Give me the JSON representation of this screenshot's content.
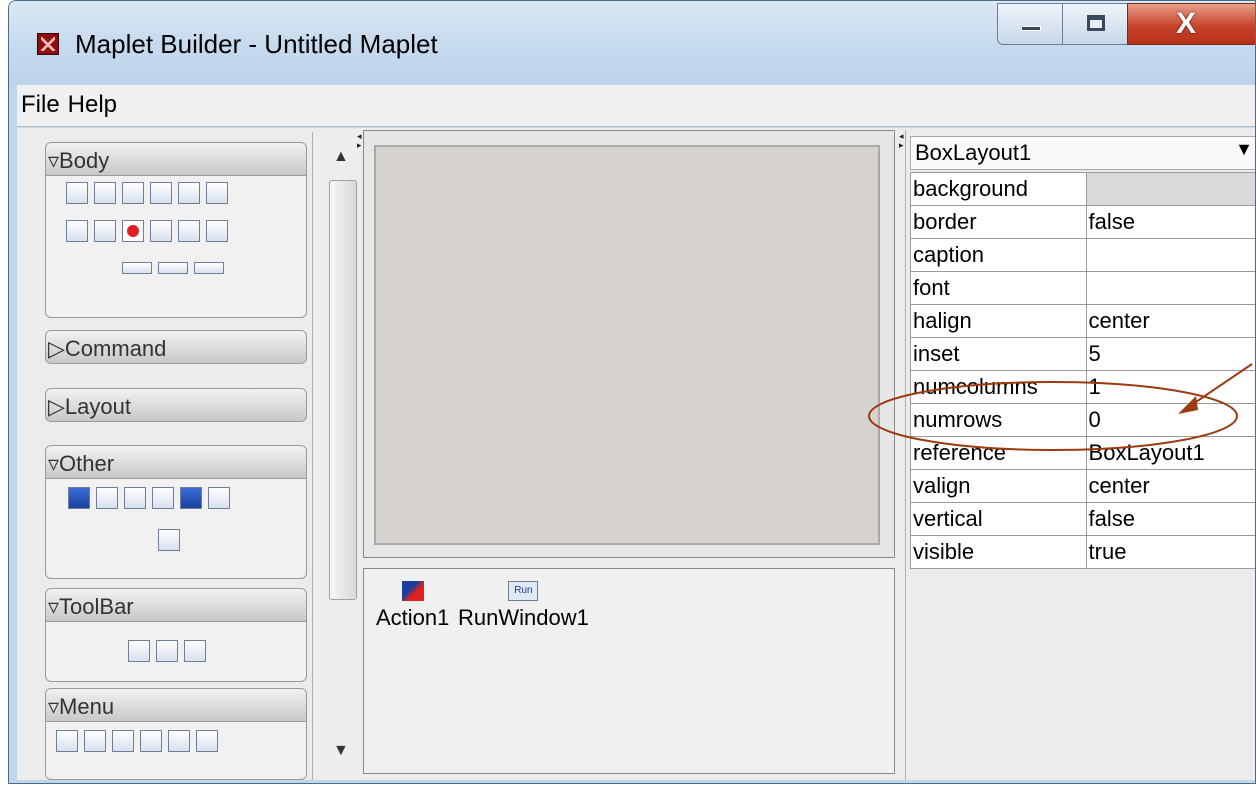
{
  "window": {
    "title": "Maplet Builder - Untitled Maplet"
  },
  "menu": [
    "File",
    "Help"
  ],
  "palette": {
    "sections": [
      {
        "label": "▿Body"
      },
      {
        "label": "▷Command"
      },
      {
        "label": "▷Layout"
      },
      {
        "label": "▿Other"
      },
      {
        "label": "▿ToolBar"
      },
      {
        "label": "▿Menu"
      }
    ]
  },
  "components": [
    {
      "label": "Action1"
    },
    {
      "label": "RunWindow1"
    }
  ],
  "properties": {
    "selected_object": "BoxLayout1",
    "rows": [
      {
        "key": "background",
        "value": ""
      },
      {
        "key": "border",
        "value": "false"
      },
      {
        "key": "caption",
        "value": ""
      },
      {
        "key": "font",
        "value": ""
      },
      {
        "key": "halign",
        "value": "center"
      },
      {
        "key": "inset",
        "value": "5"
      },
      {
        "key": "numcolumns",
        "value": "1"
      },
      {
        "key": "numrows",
        "value": "0"
      },
      {
        "key": "reference",
        "value": "BoxLayout1"
      },
      {
        "key": "valign",
        "value": "center"
      },
      {
        "key": "vertical",
        "value": "false"
      },
      {
        "key": "visible",
        "value": "true"
      }
    ]
  },
  "annotation_color": "#9c3a12",
  "run_icon_text": "Run"
}
